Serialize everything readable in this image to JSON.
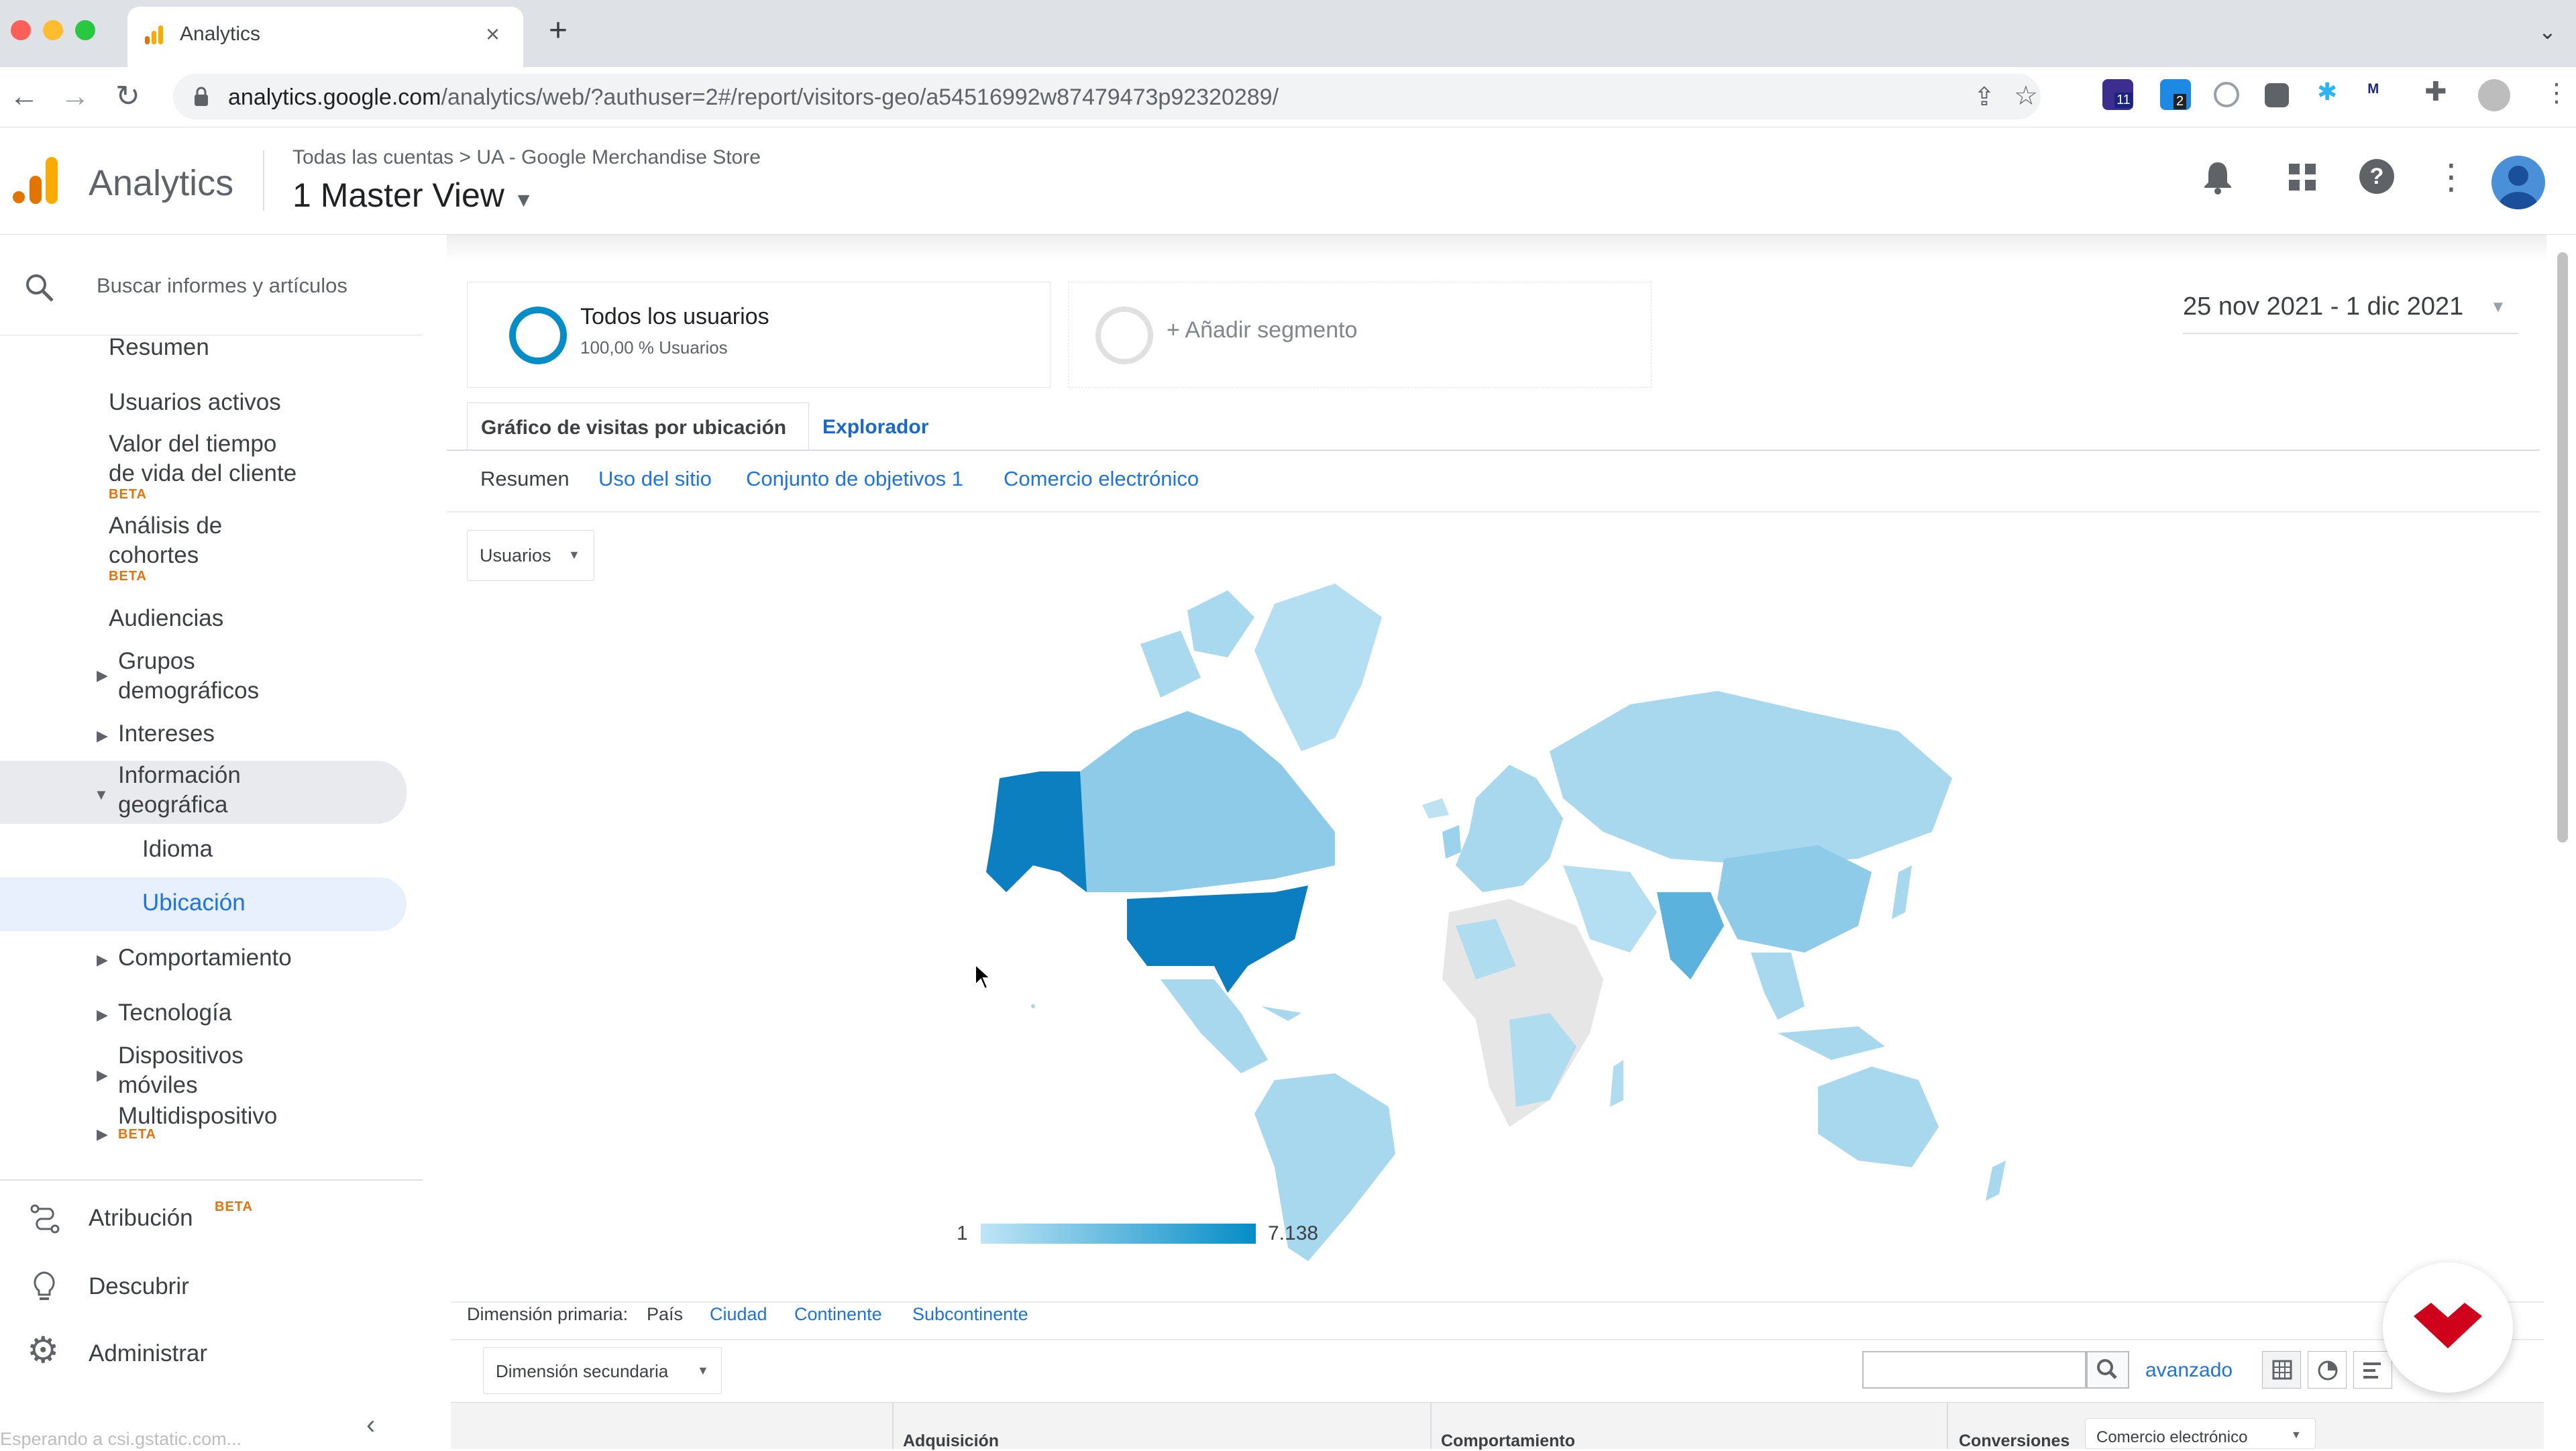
{
  "browser": {
    "tab_title": "Analytics",
    "tab_close": "×",
    "new_tab": "+",
    "url_host": "analytics.google.com",
    "url_path": "/analytics/web/?authuser=2#/report/visitors-geo/a54516992w87479473p92320289/",
    "ext_badge_1": "11",
    "ext_badge_2": "2"
  },
  "header": {
    "app_name": "Analytics",
    "breadcrumb_root": "Todas las cuentas",
    "breadcrumb_sep": ">",
    "breadcrumb_property": "UA - Google Merchandise Store",
    "view_name": "1 Master View"
  },
  "sidebar": {
    "search_placeholder": "Buscar informes y artículos",
    "items": {
      "resumen": "Resumen",
      "usuarios_activos": "Usuarios activos",
      "valor_line1": "Valor del tiempo",
      "valor_line2": "de vida del cliente",
      "analisis_line1": "Análisis de",
      "analisis_line2": "cohortes",
      "audiencias": "Audiencias",
      "grupos_line1": "Grupos",
      "grupos_line2": "demográficos",
      "intereses": "Intereses",
      "info_line1": "Información",
      "info_line2": "geográfica",
      "idioma": "Idioma",
      "ubicacion": "Ubicación",
      "comportamiento": "Comportamiento",
      "tecnologia": "Tecnología",
      "dispositivos_line1": "Dispositivos",
      "dispositivos_line2": "móviles",
      "multidispositivo": "Multidispositivo"
    },
    "beta": "BETA",
    "bottom": {
      "atribucion": "Atribución",
      "descubrir": "Descubrir",
      "administrar": "Administrar"
    },
    "status": "Esperando a csi.gstatic.com..."
  },
  "main": {
    "segment_name": "Todos los usuarios",
    "segment_sub": "100,00 % Usuarios",
    "add_segment": "+ Añadir segmento",
    "date_range": "25 nov 2021 - 1 dic 2021",
    "tabs": [
      "Gráfico de visitas por ubicación",
      "Explorador"
    ],
    "subtabs": [
      "Resumen",
      "Uso del sitio",
      "Conjunto de objetivos 1",
      "Comercio electrónico"
    ],
    "metric_select": "Usuarios",
    "legend_min": "1",
    "legend_max": "7.138",
    "primary_dimension_label": "Dimensión primaria:",
    "primary_dimensions": [
      "País",
      "Ciudad",
      "Continente",
      "Subcontinente"
    ],
    "secondary_dimension": "Dimensión secundaria",
    "advanced_link": "avanzado",
    "table_headers": [
      "Adquisición",
      "Comportamiento",
      "Conversiones"
    ],
    "conversions_select": "Comercio electrónico"
  },
  "colors": {
    "accent": "#1a73e8",
    "map_high": "#0a7fc1",
    "map_low": "#a8d8ee",
    "ga_orange": "#f9ab00",
    "ga_dark_orange": "#e37400"
  }
}
